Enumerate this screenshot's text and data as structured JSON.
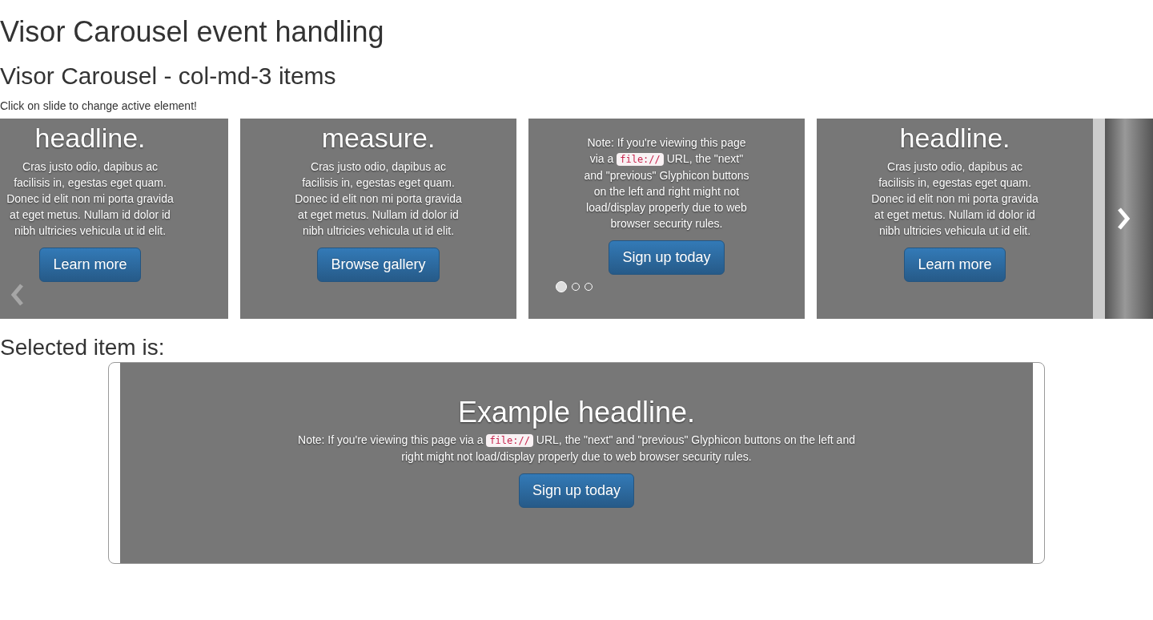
{
  "title": "Visor Carousel event handling",
  "subtitle": "Visor Carousel - col-md-3 items",
  "hint": "Click on slide to change active element!",
  "slides": [
    {
      "kind": "plain",
      "headline": "headline.",
      "text": "Cras justo odio, dapibus ac facilisis in, egestas eget quam. Donec id elit non mi porta gravida at eget metus. Nullam id dolor id nibh ultricies vehicula ut id elit.",
      "button": "Learn more"
    },
    {
      "kind": "plain",
      "headline": "measure.",
      "text": "Cras justo odio, dapibus ac facilisis in, egestas eget quam. Donec id elit non mi porta gravida at eget metus. Nullam id dolor id nibh ultricies vehicula ut id elit.",
      "button": "Browse gallery"
    },
    {
      "kind": "note",
      "text_before": "Note: If you're viewing this page via a",
      "code": "file://",
      "text_after": "URL, the \"next\" and \"previous\" Glyphicon buttons on the left and right might not load/display properly due to web browser security rules.",
      "button": "Sign up today",
      "indicators": [
        {
          "selected": true
        },
        {
          "selected": false
        },
        {
          "selected": false
        }
      ]
    },
    {
      "kind": "plain",
      "headline": "headline.",
      "text": "Cras justo odio, dapibus ac facilisis in, egestas eget quam. Donec id elit non mi porta gravida at eget metus. Nullam id dolor id nibh ultricies vehicula ut id elit.",
      "button": "Learn more"
    }
  ],
  "selected_label": "Selected item is:",
  "selected": {
    "headline": "Example headline.",
    "text_before": "Note: If you're viewing this page via a",
    "code": "file://",
    "text_after": "URL, the \"next\" and \"previous\" Glyphicon buttons on the left and right might not load/display properly due to web browser security rules.",
    "button": "Sign up today"
  }
}
